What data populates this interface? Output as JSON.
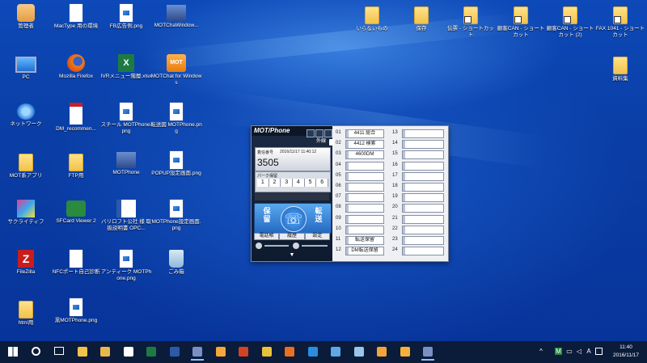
{
  "desktop": {
    "icons_left": [
      {
        "label": "管理者",
        "glyph": "user-icon"
      },
      {
        "label": "MacType 用の環境",
        "glyph": "file-icon"
      },
      {
        "label": "FB広告例.png",
        "glyph": "image-icon"
      },
      {
        "label": "MOTChaWindow...",
        "glyph": "app-icon"
      },
      {
        "label": "PC",
        "glyph": "pc-icon"
      },
      {
        "label": "Mozilla Firefox",
        "glyph": "firefox-icon"
      },
      {
        "label": "IVRメニュー階層.xlsx",
        "glyph": "excel-icon"
      },
      {
        "label": "MOTChat for Windows",
        "glyph": "mot-icon"
      },
      {
        "label": "ネットワーク",
        "glyph": "network-icon"
      },
      {
        "label": "DM_recommen...",
        "glyph": "pdf-icon"
      },
      {
        "label": "スチール MOTPhone.png",
        "glyph": "image-icon"
      },
      {
        "label": "転送図 MOTPhone.png",
        "glyph": "image-icon"
      },
      {
        "label": "MOT系アプリ",
        "glyph": "folder-icon"
      },
      {
        "label": "FTP用",
        "glyph": "folder-icon"
      },
      {
        "label": "MOTPhone",
        "glyph": "motphone-icon"
      },
      {
        "label": "POPUP設定画面.png",
        "glyph": "image-icon"
      },
      {
        "label": "サクライティフ",
        "glyph": "paint-icon"
      },
      {
        "label": "SFCard Viewer 2",
        "glyph": "sfcard-icon"
      },
      {
        "label": "バリロフト公社 様 取扱説明書 OPC...",
        "glyph": "word-icon"
      },
      {
        "label": "MOTPhone設定画面.png",
        "glyph": "image-icon"
      },
      {
        "label": "FileZilla",
        "glyph": "filezilla-icon"
      },
      {
        "label": "NFCポート自己診断",
        "glyph": "file-icon"
      },
      {
        "label": "アンティーク MOTPhone.png",
        "glyph": "image-icon"
      },
      {
        "label": "ごみ箱",
        "glyph": "recycle-bin-icon"
      },
      {
        "label": "html用",
        "glyph": "folder-icon"
      },
      {
        "label": "黒MOTPhone.png",
        "glyph": "image-icon"
      }
    ],
    "icons_right": [
      {
        "label": "いらないもの",
        "glyph": "folder-icon"
      },
      {
        "label": "保存",
        "glyph": "folder-icon"
      },
      {
        "label": "伝票 - ショートカット",
        "glyph": "folder-shortcut-icon"
      },
      {
        "label": "顧客CAN - ショートカット",
        "glyph": "folder-shortcut-icon"
      },
      {
        "label": "顧客CAN - ショートカット (2)",
        "glyph": "folder-shortcut-icon"
      },
      {
        "label": "FAX 1041 - ショートカット",
        "glyph": "folder-shortcut-icon"
      },
      {
        "label": "資料集",
        "glyph": "folder-icon"
      }
    ]
  },
  "mot": {
    "logo": "MOT/Phone",
    "ext_label": "外線",
    "display_label": "着信番号",
    "display_date": "2016/11/17  11:40:12",
    "display_number": "3505",
    "park_label": "パーク保留",
    "park_slots": [
      "1",
      "2",
      "3",
      "4",
      "5",
      "6"
    ],
    "hold_label": "保留",
    "transfer_label": "転送",
    "func_buttons": [
      "電話帳",
      "履歴",
      "設定"
    ],
    "lines": [
      {
        "num": "01",
        "label": "4411 総合"
      },
      {
        "num": "02",
        "label": "4412 検索"
      },
      {
        "num": "03",
        "label": "4600DM"
      },
      {
        "num": "04",
        "label": ""
      },
      {
        "num": "05",
        "label": ""
      },
      {
        "num": "06",
        "label": ""
      },
      {
        "num": "07",
        "label": ""
      },
      {
        "num": "08",
        "label": ""
      },
      {
        "num": "09",
        "label": ""
      },
      {
        "num": "10",
        "label": ""
      },
      {
        "num": "11",
        "label": "転送保留"
      },
      {
        "num": "12",
        "label": "DM転送保留"
      },
      {
        "num": "13",
        "label": ""
      },
      {
        "num": "14",
        "label": ""
      },
      {
        "num": "15",
        "label": ""
      },
      {
        "num": "16",
        "label": ""
      },
      {
        "num": "17",
        "label": ""
      },
      {
        "num": "18",
        "label": ""
      },
      {
        "num": "19",
        "label": ""
      },
      {
        "num": "20",
        "label": ""
      },
      {
        "num": "21",
        "label": ""
      },
      {
        "num": "22",
        "label": ""
      },
      {
        "num": "23",
        "label": ""
      },
      {
        "num": "24",
        "label": ""
      }
    ]
  },
  "taskbar": {
    "items": [
      "start-icon",
      "search-icon",
      "task-view-icon",
      "file-explorer-icon",
      "folder-icon",
      "store-icon",
      "excel-icon",
      "word-icon",
      "motphone-icon",
      "mot-icon",
      "powerpoint-icon",
      "chrome-icon",
      "firefox-icon",
      "edge-icon",
      "network-app-icon",
      "paint-icon",
      "grid-app-icon",
      "chat-app-icon",
      "motphone-icon"
    ],
    "tray_ime": "M",
    "tray_a": "A",
    "time": "11:40",
    "date": "2016/11/17"
  }
}
